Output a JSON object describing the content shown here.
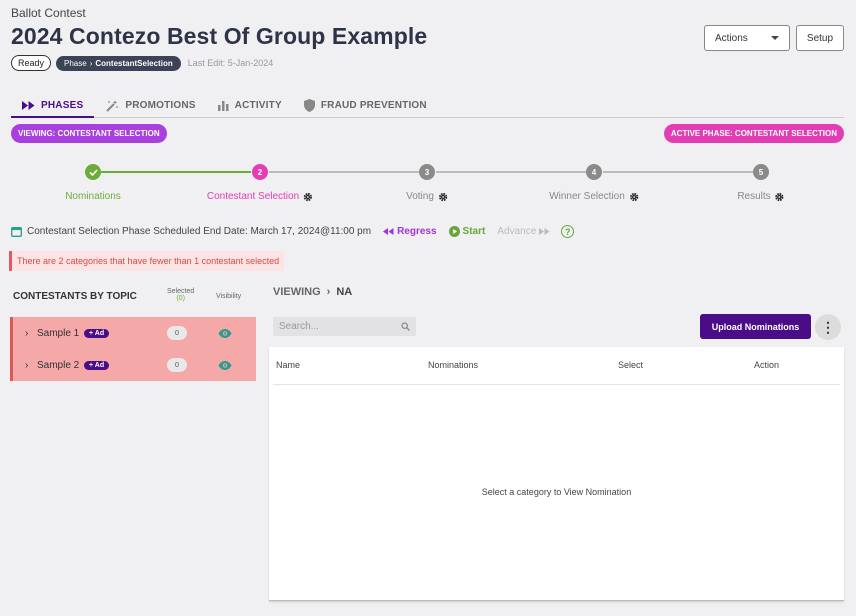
{
  "header": {
    "breadcrumb": "Ballot Contest",
    "title": "2024 Contezo Best Of Group Example",
    "status_badge": "Ready",
    "phase_prefix": "Phase",
    "phase_value": "ContestantSelection",
    "last_edit": "Last Edit: 5-Jan-2024"
  },
  "toolbar": {
    "actions_label": "Actions",
    "setup_label": "Setup"
  },
  "tabs": [
    {
      "label": "PHASES",
      "icon": "fast-forward-icon",
      "active": true
    },
    {
      "label": "PROMOTIONS",
      "icon": "magic-wand-icon",
      "active": false
    },
    {
      "label": "ACTIVITY",
      "icon": "bar-chart-icon",
      "active": false
    },
    {
      "label": "FRAUD PREVENTION",
      "icon": "shield-icon",
      "active": false
    }
  ],
  "phase_pills": {
    "viewing": "VIEWING:  CONTESTANT SELECTION",
    "active": "ACTIVE PHASE:  CONTESTANT SELECTION"
  },
  "stepper": {
    "steps": [
      {
        "number": "",
        "label": "Nominations",
        "state": "done",
        "has_gear": false
      },
      {
        "number": "2",
        "label": "Contestant Selection",
        "state": "current",
        "has_gear": true
      },
      {
        "number": "3",
        "label": "Voting",
        "state": "pending",
        "has_gear": true
      },
      {
        "number": "4",
        "label": "Winner Selection",
        "state": "pending",
        "has_gear": true
      },
      {
        "number": "5",
        "label": "Results",
        "state": "pending",
        "has_gear": true
      }
    ]
  },
  "schedule": {
    "text": "Contestant Selection Phase Scheduled End Date: March 17, 2024@11:00 pm",
    "regress_label": "Regress",
    "start_label": "Start",
    "advance_label": "Advance",
    "help_symbol": "?"
  },
  "alert": {
    "text": "There are 2 categories that have fewer than 1 contestant selected"
  },
  "topics": {
    "title": "CONTESTANTS BY TOPIC",
    "selected_header": "Selected",
    "selected_count": "(0)",
    "visibility_header": "Visibility",
    "items": [
      {
        "name": "Sample 1",
        "badge": "Ad",
        "count": "0"
      },
      {
        "name": "Sample 2",
        "badge": "Ad",
        "count": "0"
      }
    ]
  },
  "viewing": {
    "label": "VIEWING",
    "value": "NA"
  },
  "search": {
    "placeholder": "Search..."
  },
  "buttons": {
    "upload_label": "Upload Nominations",
    "more_symbol": "⋮"
  },
  "table": {
    "columns": [
      "Name",
      "Nominations",
      "Select",
      "Action"
    ],
    "empty_message": "Select a category to View Nomination"
  },
  "colors": {
    "brand_purple": "#4b0d87",
    "viewing_pill": "#a93fde",
    "active_pill": "#e23db5",
    "done_green": "#6cad3a",
    "current_pink": "#e23db5",
    "pending_gray": "#8a8a8a",
    "alert_red": "#e05b5b"
  }
}
